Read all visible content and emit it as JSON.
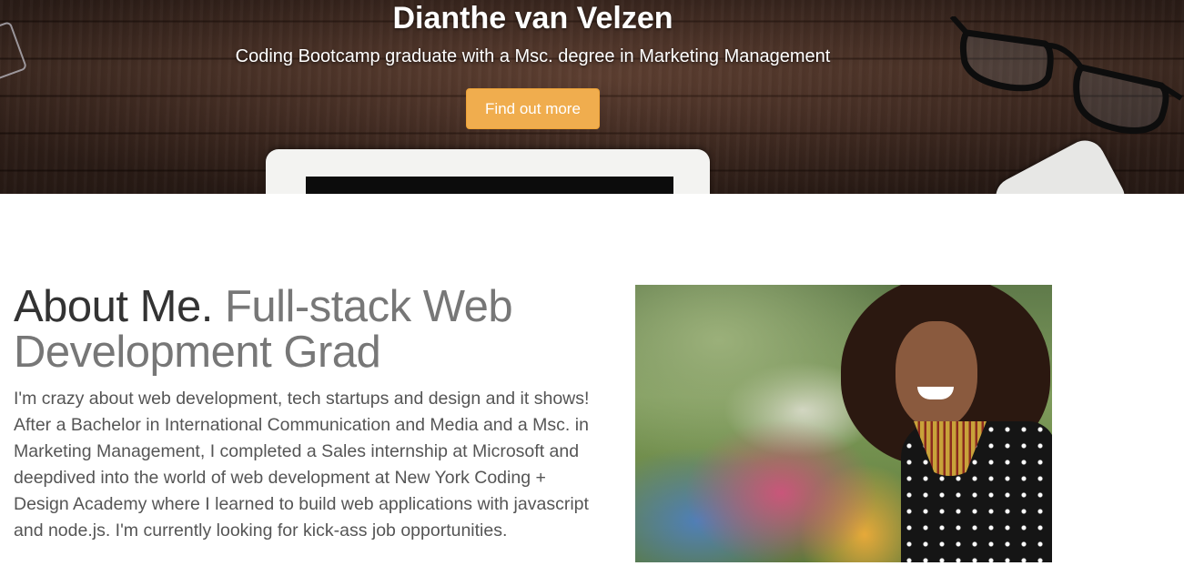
{
  "hero": {
    "title": "Dianthe van Velzen",
    "subtitle": "Coding Bootcamp graduate with a Msc. degree in Marketing Management",
    "cta_label": "Find out more",
    "cta_color": "#f0ad4e"
  },
  "about": {
    "heading_lead": "About Me.",
    "heading_rest": " Full-stack Web Development Grad",
    "body": "I'm crazy about web development, tech startups and design and it shows! After a Bachelor in International Communication and Media and a Msc. in Marketing Management, I completed a Sales internship at Microsoft and deepdived into the world of web development at New York Coding + Design Academy where I learned to build web applications with javascript and node.js. I'm currently looking for kick-ass job opportunities."
  }
}
